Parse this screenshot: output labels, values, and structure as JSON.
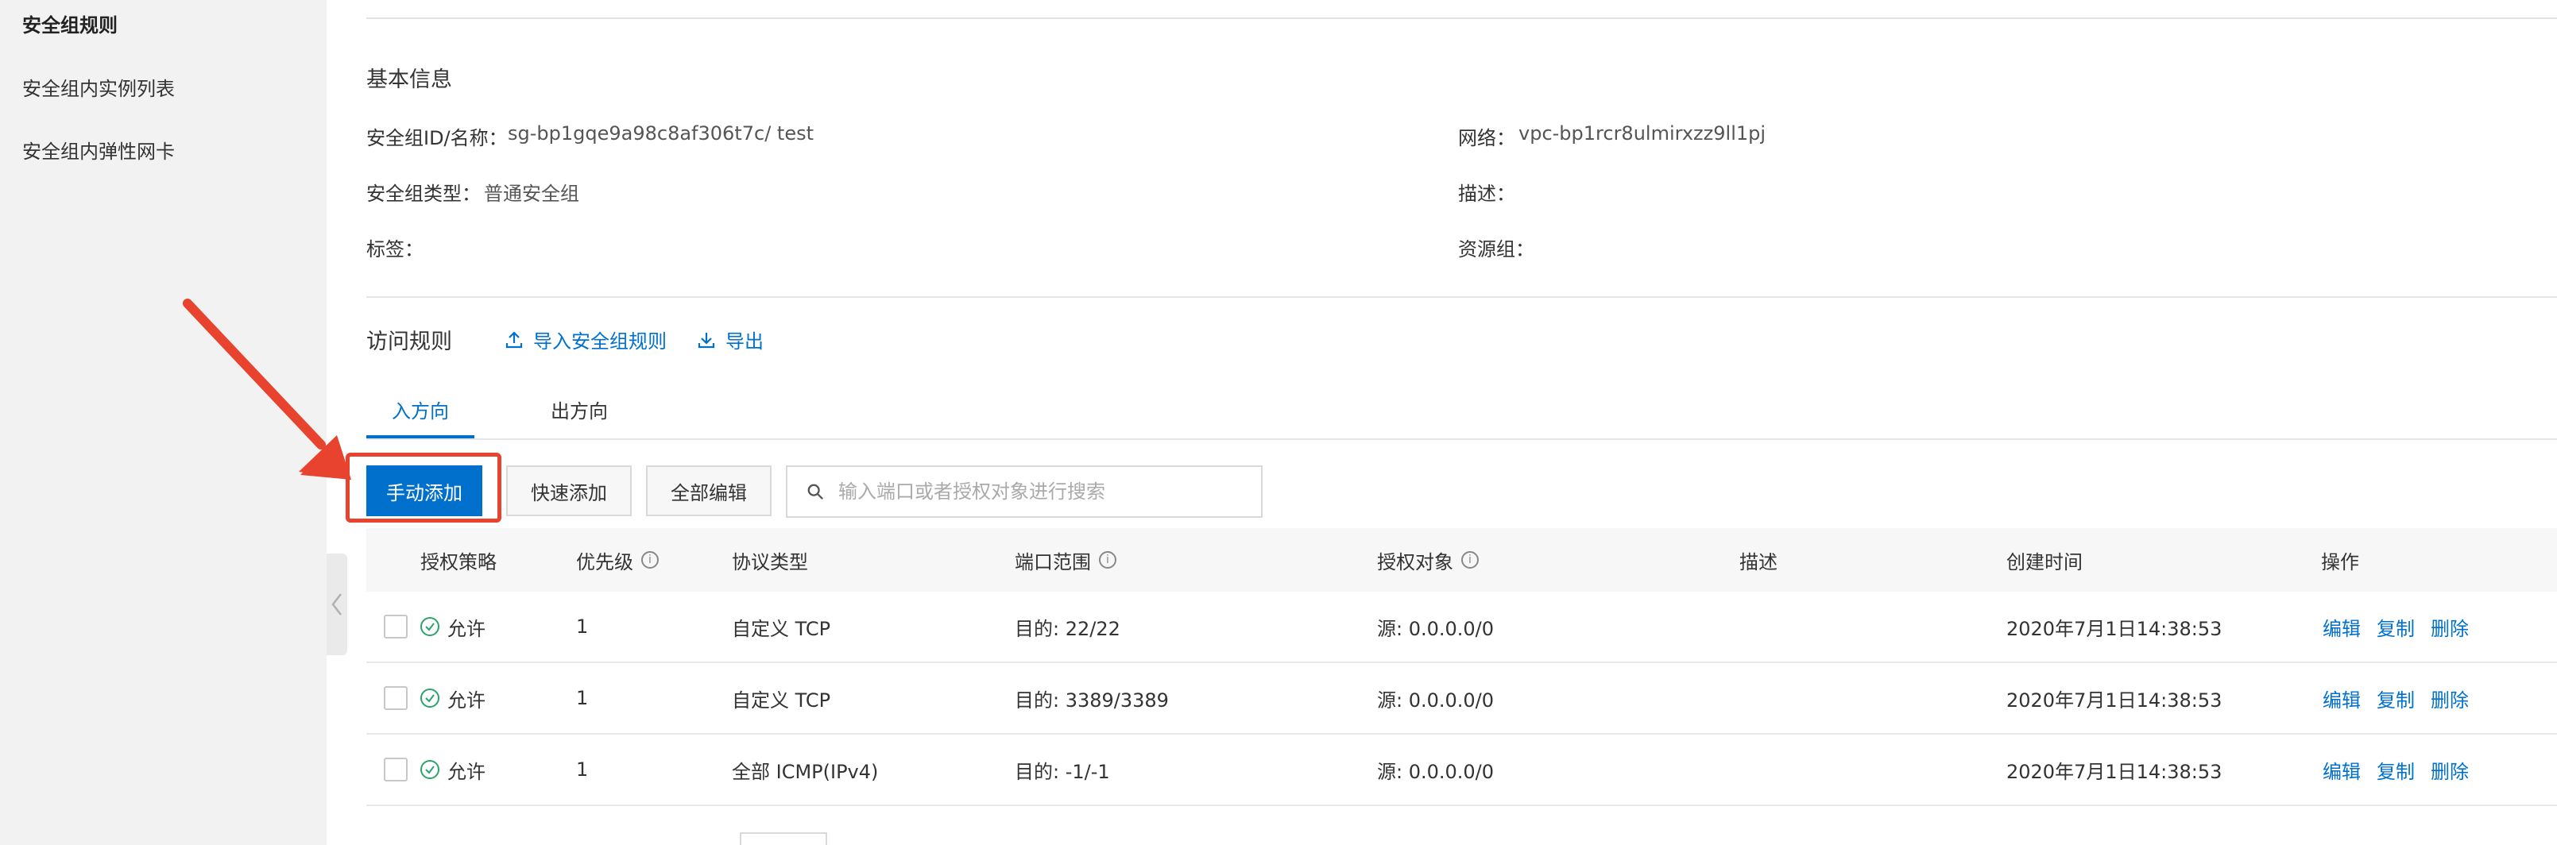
{
  "sidebar": {
    "items": [
      {
        "label": "安全组规则",
        "active": true
      },
      {
        "label": "安全组内实例列表",
        "active": false
      },
      {
        "label": "安全组内弹性网卡",
        "active": false
      }
    ]
  },
  "basic_info": {
    "title": "基本信息",
    "id_label": "安全组ID/名称：",
    "id_value": "sg-bp1gqe9a98c8af306t7c/ test",
    "network_label": "网络：",
    "network_value": "vpc-bp1rcr8ulmirxzz9ll1pj",
    "type_label": "安全组类型：",
    "type_value": "普通安全组",
    "desc_label": "描述：",
    "tags_label": "标签：",
    "resource_group_label": "资源组："
  },
  "access_rules": {
    "title": "访问规则",
    "import_label": "导入安全组规则",
    "export_label": "导出"
  },
  "tabs": [
    {
      "label": "入方向",
      "active": true
    },
    {
      "label": "出方向",
      "active": false
    }
  ],
  "toolbar": {
    "manual_add": "手动添加",
    "quick_add": "快速添加",
    "edit_all": "全部编辑",
    "search_placeholder": "输入端口或者授权对象进行搜索"
  },
  "table": {
    "headers": {
      "policy": "授权策略",
      "priority": "优先级",
      "protocol": "协议类型",
      "port_range": "端口范围",
      "target": "授权对象",
      "description": "描述",
      "created": "创建时间",
      "actions": "操作"
    },
    "rows": [
      {
        "policy": "允许",
        "priority": "1",
        "protocol": "自定义 TCP",
        "port": "目的: 22/22",
        "target": "源: 0.0.0.0/0",
        "description": "",
        "created": "2020年7月1日14:38:53"
      },
      {
        "policy": "允许",
        "priority": "1",
        "protocol": "自定义 TCP",
        "port": "目的: 3389/3389",
        "target": "源: 0.0.0.0/0",
        "description": "",
        "created": "2020年7月1日14:38:53"
      },
      {
        "policy": "允许",
        "priority": "1",
        "protocol": "全部 ICMP(IPv4)",
        "port": "目的: -1/-1",
        "target": "源: 0.0.0.0/0",
        "description": "",
        "created": "2020年7月1日14:38:53"
      }
    ],
    "actions": {
      "edit": "编辑",
      "copy": "复制",
      "delete": "删除"
    }
  },
  "colors": {
    "primary": "#0070cc",
    "annotation": "#e8432e",
    "allow": "#2ba46b"
  }
}
